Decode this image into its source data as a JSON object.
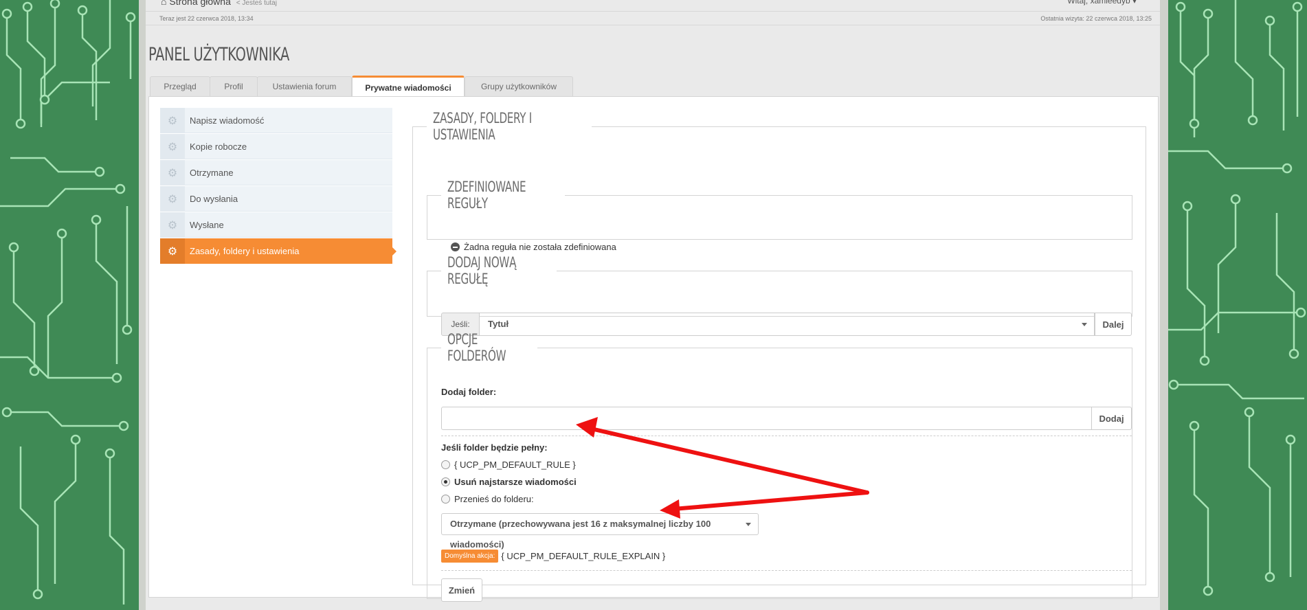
{
  "header": {
    "home_label": "Strona główna",
    "here_label": "< Jesteś tutaj",
    "welcome": "Witaj, xamieedyb ▾",
    "now": "Teraz jest 22 czerwca 2018, 13:34",
    "last_visit": "Ostatnia wizyta: 22 czerwca 2018, 13:25"
  },
  "page_title": "PANEL UŻYTKOWNIKA",
  "tabs": [
    {
      "label": "Przegląd"
    },
    {
      "label": "Profil"
    },
    {
      "label": "Ustawienia forum"
    },
    {
      "label": "Prywatne wiadomości",
      "active": true
    },
    {
      "label": "Grupy użytkowników"
    }
  ],
  "sidebar": {
    "items": [
      {
        "label": "Napisz wiadomość"
      },
      {
        "label": "Kopie robocze"
      },
      {
        "label": "Otrzymane"
      },
      {
        "label": "Do wysłania"
      },
      {
        "label": "Wysłane"
      },
      {
        "label": "Zasady, foldery i ustawienia",
        "active": true
      }
    ]
  },
  "main": {
    "title": "ZASADY, FOLDERY I USTAWIENIA",
    "defined_rules": {
      "title": "ZDEFINIOWANE REGUŁY",
      "empty_text": "Żadna reguła nie została zdefiniowana"
    },
    "add_rule": {
      "title": "DODAJ NOWĄ REGUŁĘ",
      "if_label": "Jeśli:",
      "selected": "Tytuł",
      "next_button": "Dalej"
    },
    "folder_options": {
      "title": "OPCJE FOLDERÓW",
      "add_folder_label": "Dodaj folder:",
      "add_folder_value": "",
      "add_button": "Dodaj",
      "full_label": "Jeśli folder będzie pełny:",
      "options": [
        {
          "label": "{ UCP_PM_DEFAULT_RULE }",
          "checked": false
        },
        {
          "label": "Usuń najstarsze wiadomości",
          "checked": true
        },
        {
          "label": "Przenieś do folderu:",
          "checked": false
        }
      ],
      "folder_select": "Otrzymane (przechowywana jest 16 z maksymalnej liczby 100 wiadomości)",
      "default_badge": "Domyślna akcja:",
      "default_explain": "{ UCP_PM_DEFAULT_RULE_EXPLAIN }",
      "change_button": "Zmień"
    }
  },
  "colors": {
    "accent": "#f68c34",
    "background": "#3f8a55",
    "annotation_arrow": "#ee1111"
  }
}
